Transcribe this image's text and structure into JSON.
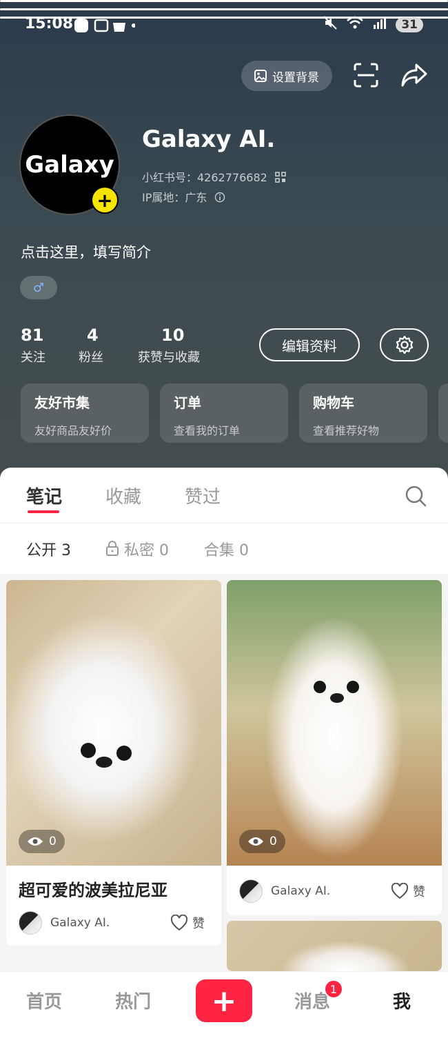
{
  "status_bar": {
    "time": "15:08",
    "battery": "31"
  },
  "header": {
    "set_background_label": "设置背景"
  },
  "profile": {
    "avatar_text": "Galaxy",
    "name": "Galaxy AI.",
    "id_label": "小红书号：4262776682",
    "ip_label": "IP属地：广东",
    "bio": "点击这里，填写简介",
    "gender_symbol": "♂"
  },
  "stats": [
    {
      "value": "81",
      "label": "关注"
    },
    {
      "value": "4",
      "label": "粉丝"
    },
    {
      "value": "10",
      "label": "获赞与收藏"
    }
  ],
  "edit_profile_label": "编辑资料",
  "cards": [
    {
      "title": "友好市集",
      "subtitle": "友好商品友好价"
    },
    {
      "title": "订单",
      "subtitle": "查看我的订单"
    },
    {
      "title": "购物车",
      "subtitle": "查看推荐好物"
    }
  ],
  "tabs": [
    "笔记",
    "收藏",
    "赞过"
  ],
  "subtabs": [
    "公开 3",
    "私密 0",
    "合集 0"
  ],
  "notes": [
    {
      "views": "0",
      "title": "超可爱的波美拉尼亚",
      "author": "Galaxy AI.",
      "like": "赞"
    },
    {
      "views": "0",
      "author": "Galaxy AI.",
      "like": "赞"
    }
  ],
  "bottom_nav": [
    "首页",
    "热门",
    "消息",
    "我"
  ],
  "post_button": "+",
  "message_badge": "1",
  "colors": {
    "accent": "#ff2442",
    "avatar_add": "#f7e300"
  }
}
